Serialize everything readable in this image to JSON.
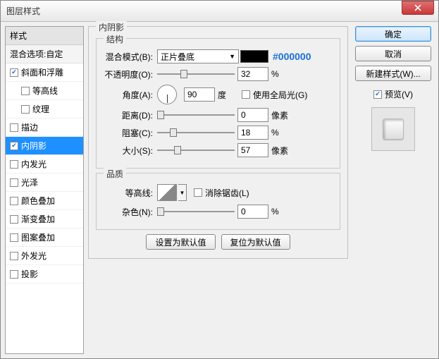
{
  "window": {
    "title": "图层样式"
  },
  "sidebar": {
    "header": "样式",
    "subheader": "混合选项:自定",
    "items": [
      {
        "label": "斜面和浮雕",
        "checked": true,
        "indent": false
      },
      {
        "label": "等高线",
        "checked": false,
        "indent": true
      },
      {
        "label": "纹理",
        "checked": false,
        "indent": true
      },
      {
        "label": "描边",
        "checked": false,
        "indent": false
      },
      {
        "label": "内阴影",
        "checked": true,
        "indent": false,
        "selected": true
      },
      {
        "label": "内发光",
        "checked": false,
        "indent": false
      },
      {
        "label": "光泽",
        "checked": false,
        "indent": false
      },
      {
        "label": "颜色叠加",
        "checked": false,
        "indent": false
      },
      {
        "label": "渐变叠加",
        "checked": false,
        "indent": false
      },
      {
        "label": "图案叠加",
        "checked": false,
        "indent": false
      },
      {
        "label": "外发光",
        "checked": false,
        "indent": false
      },
      {
        "label": "投影",
        "checked": false,
        "indent": false
      }
    ]
  },
  "panel": {
    "title": "内阴影",
    "structure_legend": "结构",
    "quality_legend": "品质",
    "blend_mode_label": "混合模式(B):",
    "blend_mode_value": "正片叠底",
    "color_hex": "#000000",
    "opacity_label": "不透明度(O):",
    "opacity_value": "32",
    "percent": "%",
    "angle_label": "角度(A):",
    "angle_value": "90",
    "degree": "度",
    "global_light_label": "使用全局光(G)",
    "distance_label": "距离(D):",
    "distance_value": "0",
    "px": "像素",
    "choke_label": "阻塞(C):",
    "choke_value": "18",
    "size_label": "大小(S):",
    "size_value": "57",
    "contour_label": "等高线:",
    "antialias_label": "消除锯齿(L)",
    "noise_label": "杂色(N):",
    "noise_value": "0",
    "set_default": "设置为默认值",
    "reset_default": "复位为默认值"
  },
  "right": {
    "ok": "确定",
    "cancel": "取消",
    "new_style": "新建样式(W)...",
    "preview": "预览(V)"
  },
  "colors": {
    "swatch": "#000000"
  }
}
